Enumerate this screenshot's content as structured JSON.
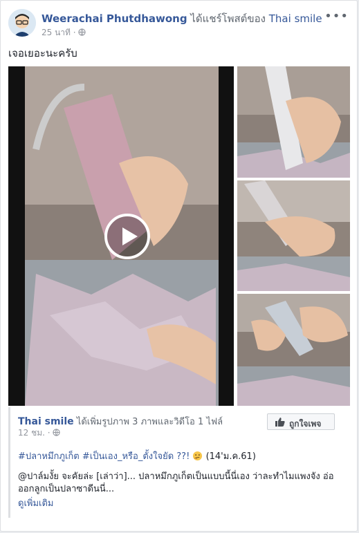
{
  "post": {
    "author": "Weerachai Phutdhawong",
    "shared_text": "ได้แชร์โพสต์ของ",
    "page_name": "Thai smile",
    "time": "25 นาที",
    "caption": "เจอเยอะนะครับ"
  },
  "shared_post": {
    "page_name": "Thai smile",
    "action_text": "ได้เพิ่มรูปภาพ 3 ภาพและวิดีโอ 1 ไฟล์",
    "time": "12 ชม.",
    "like_button_label": "ถูกใจเพจ",
    "hashtag_1": "#ปลาหมึกภูเก็ต",
    "hashtag_2": "#เป็นเอง_หรือ_ตั้งใจยัด ??!",
    "date_note": "(14'ม.ค.61)",
    "mention": "@ปาล์มงั้ย",
    "body": " จะคัยล่ะ [เล่าว่า]... ปลาหมึกภูเก็ตเป็นแบบนี้นี่เอง ว่าละทำไมแพงจัง อ่อ ออกลูกเป็นปลาซาดีนนี่...",
    "see_more": "ดูเพิ่มเติม"
  },
  "icons": {
    "more": "more-dots-icon",
    "privacy": "globe-icon",
    "play": "play-icon",
    "like": "thumbs-up-icon"
  },
  "colors": {
    "link": "#365899",
    "text": "#1d2129",
    "muted": "#90949c"
  }
}
